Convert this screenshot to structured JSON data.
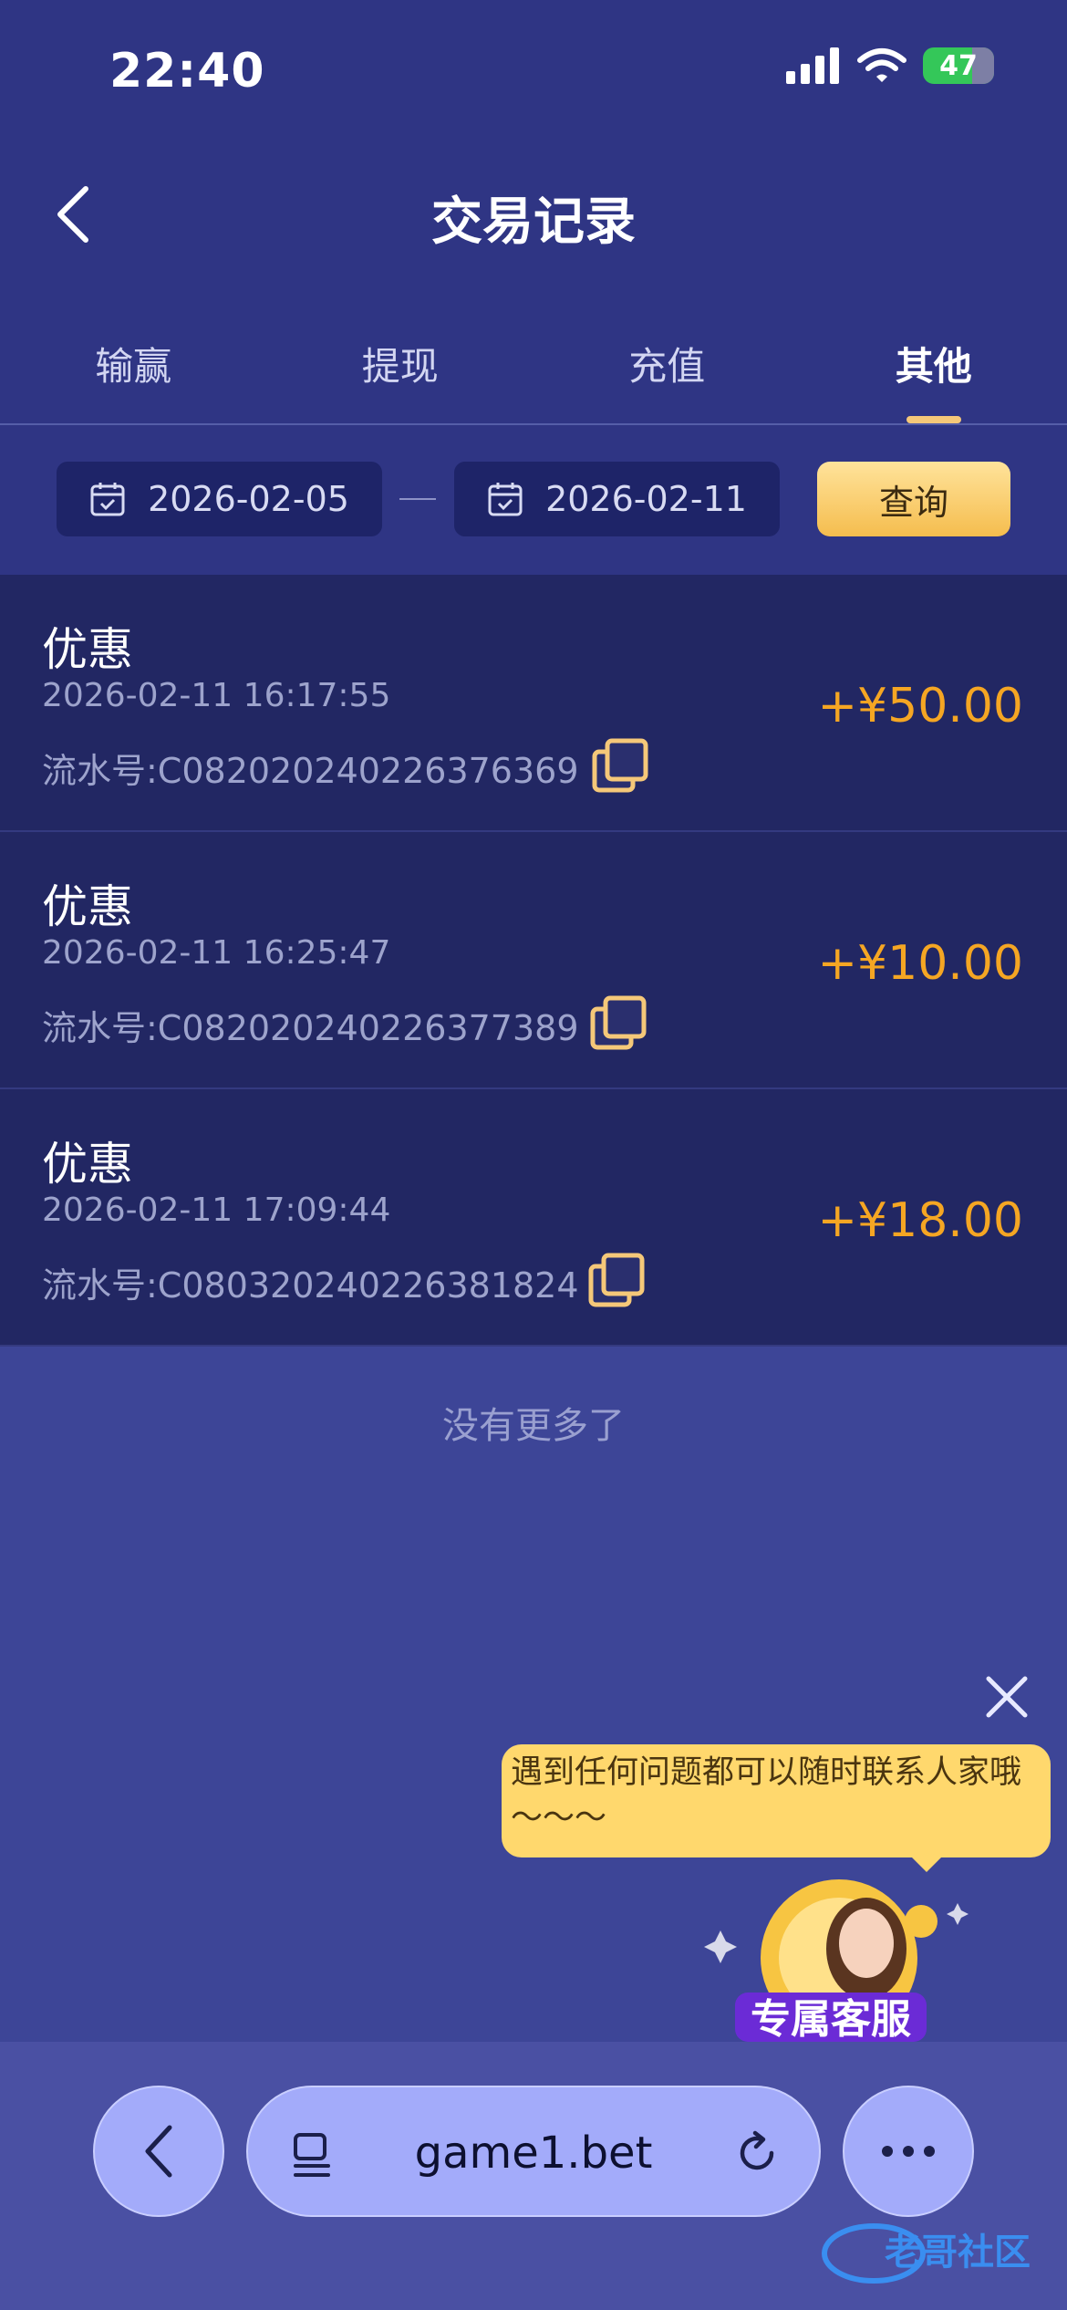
{
  "status_bar": {
    "time": "22:40",
    "battery": "47"
  },
  "header": {
    "title": "交易记录"
  },
  "tabs": [
    {
      "label": "输赢",
      "active": false
    },
    {
      "label": "提现",
      "active": false
    },
    {
      "label": "充值",
      "active": false
    },
    {
      "label": "其他",
      "active": true
    }
  ],
  "filter": {
    "start_date": "2026-02-05",
    "end_date": "2026-02-11",
    "query_label": "查询"
  },
  "records": [
    {
      "type": "优惠",
      "time": "2026-02-11 16:17:55",
      "serial": "流水号:C082020240226376369",
      "amount": "+¥50.00"
    },
    {
      "type": "优惠",
      "time": "2026-02-11 16:25:47",
      "serial": "流水号:C082020240226377389",
      "amount": "+¥10.00"
    },
    {
      "type": "优惠",
      "time": "2026-02-11 17:09:44",
      "serial": "流水号:C080320240226381824",
      "amount": "+¥18.00"
    }
  ],
  "no_more_text": "没有更多了",
  "support_widget": {
    "bubble_text": "遇到任何问题都可以随时联系人家哦～～～",
    "badge_text": "专属客服"
  },
  "browser": {
    "url": "game1.bet"
  },
  "watermark_text": "老哥社区",
  "colors": {
    "amount": "#f5a623",
    "accent": "#f5c879",
    "background": "#3d4597"
  }
}
